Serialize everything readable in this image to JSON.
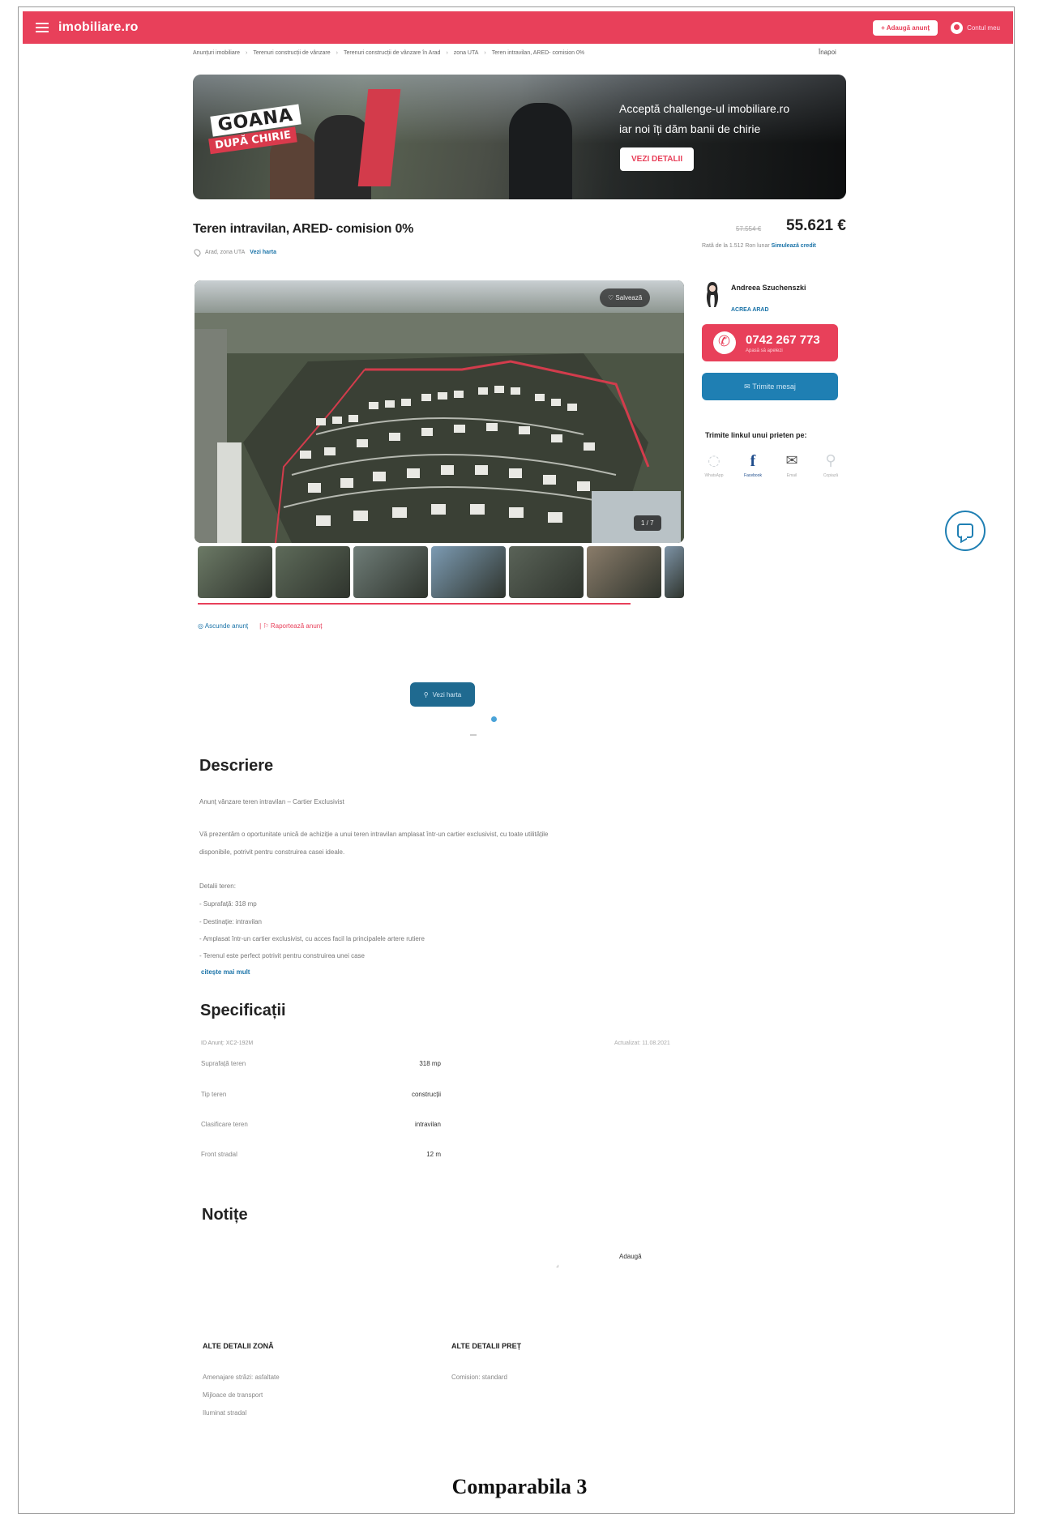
{
  "header": {
    "logo": "imobiliare.ro",
    "add_button": "+ Adaugă anunț",
    "account_label": "Contul meu"
  },
  "breadcrumb": [
    "Anunțuri imobiliare",
    "Terenuri construcții de vânzare",
    "Terenuri construcții de vânzare în Arad",
    "zona UTA",
    "Teren intravilan, ARED- comision 0%"
  ],
  "back_link": "Înapoi",
  "banner": {
    "goana_line1": "GOANA",
    "goana_line2": "DUPĂ CHIRIE",
    "line1": "Acceptă challenge-ul imobiliare.ro",
    "line2": "iar noi îți dăm banii de chirie",
    "cta": "VEZI DETALII"
  },
  "listing": {
    "title": "Teren intravilan, ARED- comision 0%",
    "location": "Arad, zona UTA",
    "map_link": "Vezi harta",
    "price_old": "57.554 €",
    "price": "55.621 €",
    "rate_text": "Rată de la 1.512 Ron lunar",
    "rate_link": "Simulează credit"
  },
  "gallery": {
    "save_label": "Salvează",
    "counter": "1 / 7",
    "thumb_colors": [
      "#6c7a66",
      "#5e6b5a",
      "#6f7d78",
      "#7c9bb3",
      "#5a6358",
      "#8a7c6a",
      "#7d93a6"
    ]
  },
  "actions": {
    "hide": "Ascunde anunț",
    "report": "Raportează anunț"
  },
  "agent": {
    "name": "Andreea Szuchenszki",
    "agency": "ACREA ARAD",
    "phone": "0742 267 773",
    "phone_sub": "Apasă să apelezi",
    "message_button": "Trimite mesaj"
  },
  "share": {
    "title": "Trimite linkul unui prieten pe:",
    "items": [
      {
        "icon": "whatsapp-icon",
        "label": "WhatsApp"
      },
      {
        "icon": "facebook-icon",
        "label": "Facebook"
      },
      {
        "icon": "email-icon",
        "label": "Email"
      },
      {
        "icon": "link-icon",
        "label": "Copiază"
      }
    ]
  },
  "map_button": "Vezi harta",
  "description": {
    "heading": "Descriere",
    "lines": [
      "Anunț vânzare teren intravilan – Cartier Exclusivist",
      "Vă prezentăm o oportunitate unică de achiziție a unui teren intravilan amplasat într-un cartier exclusivist, cu toate utilitățile",
      "disponibile, potrivit pentru construirea casei ideale.",
      "Detalii teren:",
      "- Suprafață: 318 mp",
      "- Destinație: intravilan",
      "- Amplasat într-un cartier exclusivist, cu acces facil la principalele artere rutiere",
      "- Terenul este perfect potrivit pentru construirea unei case"
    ],
    "read_more": "citește mai mult"
  },
  "specs": {
    "heading": "Specificații",
    "id": "ID Anunț: XC2-192M",
    "updated": "Actualizat: 11.08.2021",
    "rows": [
      {
        "key": "Suprafață teren",
        "value": "318 mp"
      },
      {
        "key": "Tip teren",
        "value": "construcții"
      },
      {
        "key": "Clasificare teren",
        "value": "intravilan"
      },
      {
        "key": "Front stradal",
        "value": "12 m"
      }
    ]
  },
  "notes": {
    "heading": "Notițe",
    "add": "Adaugă",
    "mark": "⌟"
  },
  "zone_details": {
    "title": "ALTE DETALII ZONĂ",
    "items": [
      "Amenajare străzi: asfaltate",
      "Mijloace de transport",
      "Iluminat stradal"
    ]
  },
  "price_details": {
    "title": "ALTE DETALII PREȚ",
    "items": [
      "Comision: standard"
    ]
  },
  "caption": "Comparabila 3",
  "colors": {
    "brand": "#e8405a",
    "blue": "#1f7fb3",
    "link": "#1a73a8"
  }
}
